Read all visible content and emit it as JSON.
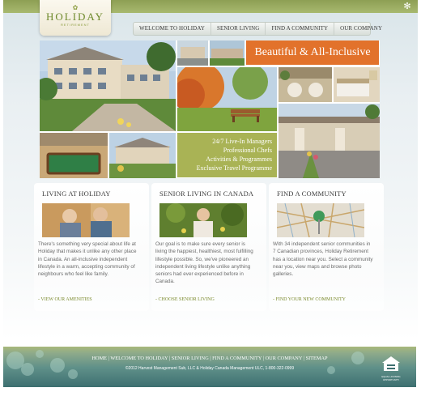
{
  "brand": {
    "mark": "✿",
    "name": "HOLIDAY",
    "tagline": "RETIREMENT"
  },
  "nav": {
    "items": [
      "WELCOME TO HOLIDAY",
      "SENIOR LIVING",
      "FIND A COMMUNITY",
      "OUR COMPANY"
    ]
  },
  "hero": {
    "banner": "Beautiful & All-Inclusive",
    "promo_lines": [
      "24/7 Live-In Managers",
      "Professional Chefs",
      "Activities & Programmes",
      "Exclusive Travel Programme"
    ]
  },
  "cards": [
    {
      "title": "LIVING AT HOLIDAY",
      "body": "There's something very special about life at Holiday that makes it unlike any other place in Canada. An all-inclusive independent lifestyle in a warm, accepting community of neighbours who feel like family.",
      "link": "- VIEW OUR AMENITIES"
    },
    {
      "title": "SENIOR LIVING IN CANADA",
      "body": "Our goal is to make sure every senior is living the happiest, healthiest, most fulfilling lifestyle possible. So, we've pioneered an independent living lifestyle unlike anything seniors had ever experienced before in Canada.",
      "link": "- CHOOSE SENIOR LIVING"
    },
    {
      "title": "FIND A COMMUNITY",
      "body": "With 34 independent senior communities in 7 Canadian provinces, Holiday Retirement has a location near you. Select a community near you, view maps and browse photo galleries.",
      "link": "- FIND YOUR NEW COMMUNITY"
    }
  ],
  "footer": {
    "links": [
      "HOME",
      "WELCOME TO HOLIDAY",
      "SENIOR LIVING",
      "FIND A COMMUNITY",
      "OUR COMPANY",
      "SITEMAP"
    ],
    "separator": " | ",
    "copyright": "©2012 Harvest Management Sub, LLC & Holiday Canada Management ULC, 1-800-322-0999",
    "eho_badge": "EQUAL HOUSING OPPORTUNITY"
  },
  "colors": {
    "accent_orange": "#e2722b",
    "accent_olive": "#a9b355",
    "link_green": "#7a8a2c"
  }
}
